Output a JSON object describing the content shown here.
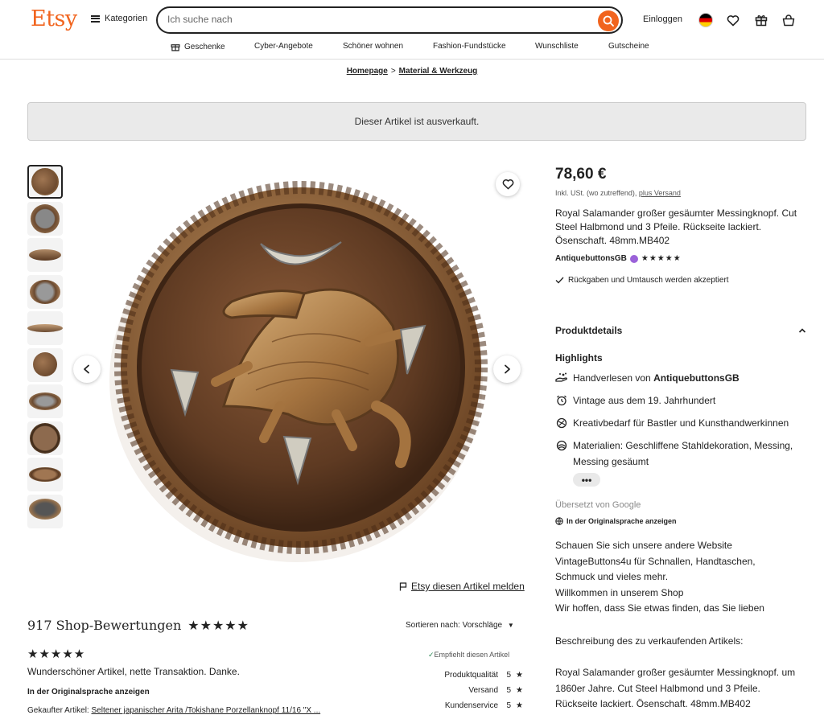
{
  "header": {
    "logo": "Etsy",
    "categories": "Kategorien",
    "search_placeholder": "Ich suche nach",
    "login": "Einloggen",
    "nav": [
      "Geschenke",
      "Cyber-Angebote",
      "Schöner wohnen",
      "Fashion-Fundstücke",
      "Wunschliste",
      "Gutscheine"
    ]
  },
  "breadcrumb": {
    "home": "Homepage",
    "sep": ">",
    "category": "Material & Werkzeug"
  },
  "soldout": "Dieser Artikel ist ausverkauft.",
  "gallery": {
    "report": "Etsy diesen Artikel melden"
  },
  "listing": {
    "price": "78,60 €",
    "tax": "Inkl. USt. (wo zutreffend),",
    "shipping_link": "plus Versand",
    "title": "Royal Salamander großer gesäumter Messingknopf. Cut Steel Halbmond und 3 Pfeile. Rückseite lackiert. Ösenschaft. 48mm.MB402",
    "shop_name": "AntiquebuttonsGB",
    "shop_stars": "★★★★★",
    "returns": "Rückgaben und Umtausch werden akzeptiert"
  },
  "details": {
    "heading": "Produktdetails",
    "highlights": "Highlights",
    "handpicked_prefix": "Handverlesen von ",
    "handpicked_shop": "AntiquebuttonsGB",
    "vintage": "Vintage aus dem 19. Jahrhundert",
    "craft": "Kreativbedarf für Bastler und Kunsthandwerkinnen",
    "materials_line1": "Materialien: Geschliffene Stahldekoration, Messing,",
    "materials_line2": "Messing gesäumt",
    "more": "•••",
    "translated": "Übersetzt von Google",
    "original_lang": "In der Originalsprache anzeigen"
  },
  "description": {
    "lines1": [
      "Schauen Sie sich unsere andere Website",
      "VintageButtons4u für Schnallen, Handtaschen,",
      "Schmuck und vieles mehr.",
      "Willkommen in unserem Shop",
      "Wir hoffen, dass Sie etwas finden, das Sie lieben"
    ],
    "heading": "Beschreibung des zu verkaufenden Artikels:",
    "lines2": [
      "Royal Salamander großer gesäumter Messingknopf. um",
      "1860er Jahre. Cut Steel Halbmond und 3 Pfeile.",
      "Rückseite lackiert. Ösenschaft. 48mm.MB402"
    ]
  },
  "reviews": {
    "title": "917 Shop-Bewertungen",
    "title_stars": "★★★★★",
    "sort_label": "Sortieren nach: Vorschläge",
    "review_stars": "★★★★★",
    "review_text": "Wunderschöner Artikel, nette Transaktion. Danke.",
    "original_lang": "In der Originalsprache anzeigen",
    "bought_label": "Gekaufter Artikel:",
    "bought_item": "Seltener japanischer Arita /Tokishane Porzellanknopf 11/16 \"X ...",
    "recommends": "Empfiehlt diesen Artikel",
    "ratings": [
      {
        "label": "Produktqualität",
        "value": "5"
      },
      {
        "label": "Versand",
        "value": "5"
      },
      {
        "label": "Kundenservice",
        "value": "5"
      }
    ]
  }
}
